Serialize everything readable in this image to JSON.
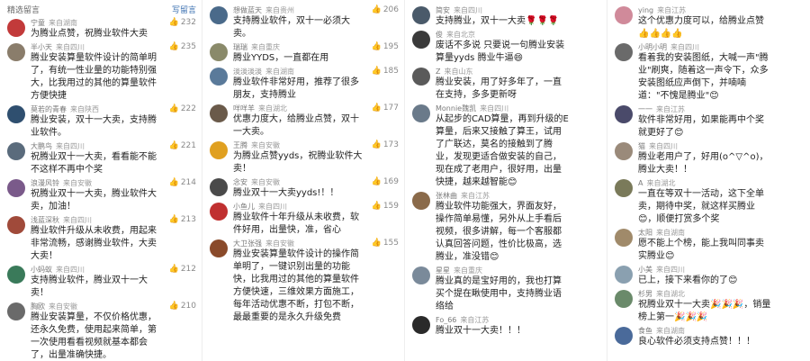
{
  "header": {
    "left": "精选留言",
    "right": "写留言"
  },
  "columns": [
    {
      "comments": [
        {
          "name": "宁童",
          "loc": "来自湖南",
          "text": "为腾业点赞，祝腾业软件大卖",
          "likes": "232",
          "color": "#c23a3a"
        },
        {
          "name": "半小天",
          "loc": "来自四川",
          "text": "腾业安装算量软件设计的简单明了，有统一性业量的功能特别强大，比我用过的其他的算量软件方便快捷",
          "likes": "235",
          "color": "#8a7d6b"
        },
        {
          "name": "莫若的青春",
          "loc": "来自陕西",
          "text": "腾业安装，双十一大卖，支持腾业软件。",
          "likes": "222",
          "color": "#2f4f6f"
        },
        {
          "name": "大鹏鸟",
          "loc": "来自四川",
          "text": "祝腾业双十一大卖，看看能不能不这样不再中个奖",
          "likes": "221",
          "color": "#5a6b7c"
        },
        {
          "name": "浪漫风铃",
          "loc": "来自安徽",
          "text": "祝腾业双十一大卖，腾业软件大卖，加油！",
          "likes": "214",
          "color": "#7a5a8a"
        },
        {
          "name": "浅蓝深秋",
          "loc": "来自四川",
          "text": "腾业软件升级从未收费，用起来非常流畅，感谢腾业软件，大卖大卖！",
          "likes": "213",
          "color": "#a04a3a"
        },
        {
          "name": "小蚂蚁",
          "loc": "来自四川",
          "text": "支持腾业软件，腾业双十一大卖！",
          "likes": "212",
          "color": "#3a7a5a"
        },
        {
          "name": "胸欧",
          "loc": "来自安徽",
          "text": "腾业安装算量，不仅价格优惠，还永久免费，使用起来简单，第一次使用看看视频就基本都会了，出量准确快捷。",
          "likes": "210",
          "color": "#6a6a6a"
        }
      ]
    },
    {
      "comments": [
        {
          "name": "想做蓝天",
          "loc": "来自贵州",
          "text": "支持腾业软件，双十一必须大卖。",
          "likes": "206",
          "color": "#4a6a8a"
        },
        {
          "name": "瑞瑞",
          "loc": "来自重庆",
          "text": "腾业YYDS，一直都在用",
          "likes": "195",
          "color": "#8a8a6a"
        },
        {
          "name": "淡淡淡淡",
          "loc": "来自湖南",
          "text": "腾业软件非常好用，推荐了很多朋友，支持腾业",
          "likes": "185",
          "color": "#5a7a9a"
        },
        {
          "name": "咩咩羊",
          "loc": "来自湖北",
          "text": "优惠力度大，给腾业点赞，双十一大卖。",
          "likes": "177",
          "color": "#6a5a4a"
        },
        {
          "name": "王腾",
          "loc": "来自安徽",
          "text": "为腾业点赞yyds，祝腾业软件大卖！",
          "likes": "173",
          "color": "#e0a020"
        },
        {
          "name": "念安",
          "loc": "来自安徽",
          "text": "腾业双十一大卖yyds!！！",
          "likes": "169",
          "color": "#4a4a4a"
        },
        {
          "name": "小鱼儿",
          "loc": "来自四川",
          "text": "腾业软件十年升级从未收费，软件好用，出量快，准，省心",
          "likes": "159",
          "color": "#c03030"
        },
        {
          "name": "大卫张强",
          "loc": "来自安徽",
          "text": "腾业安装算量软件设计的操作简单明了，一键识别出量的功能快，比我用过的其他的算量软件方便快速，三维效果方面施工，每年活动优惠不断，打包不断，最最重要的是永久升级免费",
          "likes": "155",
          "color": "#8a4a2a"
        }
      ]
    },
    {
      "comments": [
        {
          "name": "简安",
          "loc": "来自四川",
          "text": "支持腾业，双十一大卖🌹🌹🌹",
          "likes": "",
          "color": "#4a5a6a"
        },
        {
          "name": "俊",
          "loc": "来自北京",
          "text": "废话不多说 只要说一句腾业安装算量yyds 腾业牛逼😄",
          "likes": "",
          "color": "#3a3a3a"
        },
        {
          "name": "Z",
          "loc": "来自山东",
          "text": "腾业安装，用了好多年了，一直在支持，多多更新呀",
          "likes": "",
          "color": "#5a5a5a"
        },
        {
          "name": "Monnie魏凯",
          "loc": "来自四川",
          "text": "从起步的CAD算量，再到升级的E算量，后来又接触了算王，试用了广联达，莫名的接触到了腾业，发现更适合做安装的自己，现在成了老用户，很好用，出量快捷，越来越智能😊",
          "likes": "",
          "color": "#6a7a8a"
        },
        {
          "name": "张林曲",
          "loc": "来自江苏",
          "text": "腾业软件功能强大，界面友好，操作简单易懂，另外从上手看后视频，很多讲解，每一个客服都认真回答问题，性价比极高，选腾业，准没错😊",
          "likes": "",
          "color": "#8a6a4a"
        },
        {
          "name": "星星",
          "loc": "来自重庆",
          "text": "腾业真的是宝好用的，我也打算买个提在瞅使用中，支持腾业语络给",
          "likes": "",
          "color": "#7a8a9a"
        },
        {
          "name": "Fo_66",
          "loc": "来自江苏",
          "text": "腾业双十一大卖！！！",
          "likes": "",
          "color": "#2a2a2a"
        }
      ]
    },
    {
      "comments": [
        {
          "name": "ying",
          "loc": "来自江苏",
          "text": "这个优惠力度可以，给腾业点赞👍👍👍👍",
          "likes": "",
          "color": "#d08a9a"
        },
        {
          "name": "小明小明",
          "loc": "来自四川",
          "text": "看着我的安装图纸，大喊一声\"腾业\"刷爽，随着这一声令下，众多安装图纸应声倒下，并喃喃道：\"不愧是腾业\"😊",
          "likes": "",
          "color": "#6a6a6a"
        },
        {
          "name": "一一",
          "loc": "来自江苏",
          "text": "软件非常好用，如果能再中个奖就更好了😊",
          "likes": "",
          "color": "#4a4a6a"
        },
        {
          "name": "猫",
          "loc": "来自四川",
          "text": "腾业老用户了，好用(o^▽^o)，腾业大卖！！",
          "likes": "",
          "color": "#9a8a7a"
        },
        {
          "name": "A",
          "loc": "来自湖北",
          "text": "一直在等双十一活动，这下全单卖，期待中奖，就这样买腾业😊，顺便打赏多个奖",
          "likes": "",
          "color": "#7a7a5a"
        },
        {
          "name": "太阳",
          "loc": "来自湖南",
          "text": "愿不能上个榜，能上我叫同事卖实腾业😊",
          "likes": "",
          "color": "#a08a6a"
        },
        {
          "name": "小美",
          "loc": "来自四川",
          "text": "已上，接下来看你的了😊",
          "likes": "",
          "color": "#8aa0b0"
        },
        {
          "name": "杉男",
          "loc": "来自湖北",
          "text": "祝腾业双十一大卖🎉🎉🎉，销量榜上第一🎉🎉🎉",
          "likes": "",
          "color": "#6a8a6a"
        },
        {
          "name": "食鱼",
          "loc": "来自湖南",
          "text": "良心软件必须支持点赞！！！",
          "likes": "",
          "color": "#4a6a9a"
        }
      ]
    }
  ]
}
